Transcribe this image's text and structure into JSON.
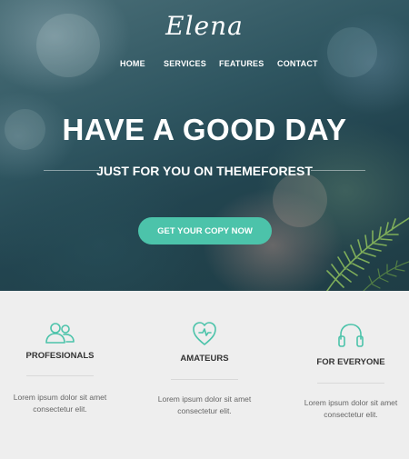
{
  "brand": {
    "logo_text": "Elena"
  },
  "nav": {
    "items": [
      {
        "label": "HOME"
      },
      {
        "label": "SERVICES"
      },
      {
        "label": "FEATURES"
      },
      {
        "label": "CONTACT"
      }
    ]
  },
  "hero": {
    "headline": "HAVE A GOOD DAY",
    "subheadline": "JUST FOR YOU ON THEMEFOREST",
    "cta_label": "GET YOUR COPY NOW"
  },
  "features": {
    "items": [
      {
        "icon": "users-icon",
        "title": "PROFESIONALS",
        "line1": "Lorem ipsum dolor sit amet",
        "line2": "consectetur elit."
      },
      {
        "icon": "heart-icon",
        "title": "AMATEURS",
        "line1": "Lorem ipsum dolor sit amet",
        "line2": "consectetur elit."
      },
      {
        "icon": "headphones-icon",
        "title": "FOR EVERYONE",
        "line1": "Lorem ipsum dolor sit amet",
        "line2": "consectetur elit."
      }
    ]
  },
  "colors": {
    "accent": "#4cc3aa",
    "section_bg": "#eeeeee",
    "text_dark": "#333333",
    "text_muted": "#666666"
  }
}
